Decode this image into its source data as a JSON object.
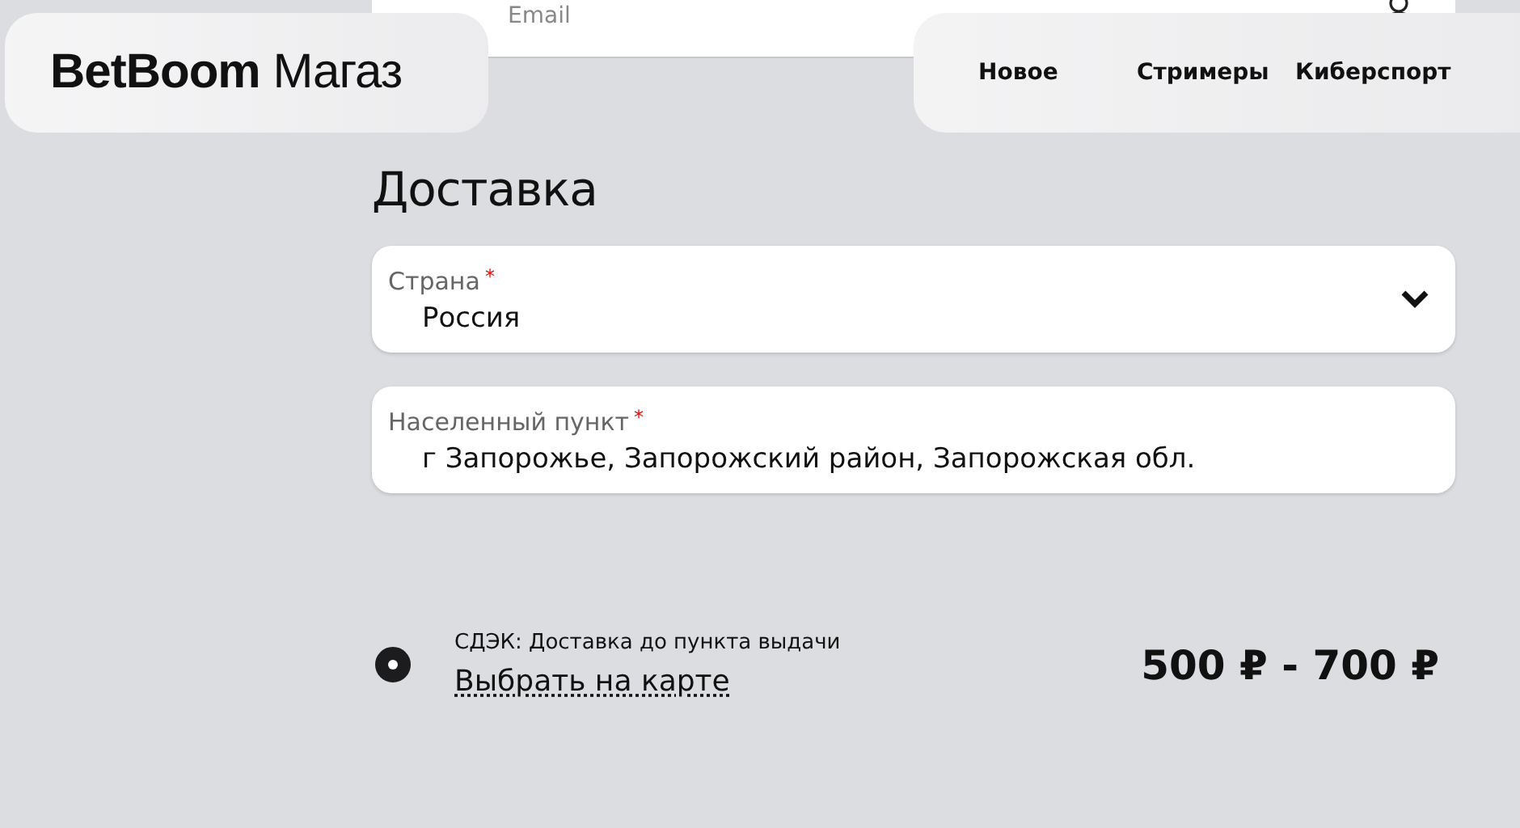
{
  "email_field": {
    "placeholder": "Email"
  },
  "header": {
    "logo": {
      "bold": "BetBoom",
      "rest": "Магаз"
    },
    "nav": [
      {
        "label": "Новое"
      },
      {
        "label": "Стримеры"
      },
      {
        "label": "Киберспорт"
      }
    ]
  },
  "delivery": {
    "title": "Доставка",
    "fields": [
      {
        "kind": "select",
        "label": "Страна",
        "required_mark": "*",
        "value": "Россия"
      },
      {
        "kind": "text",
        "label": "Населенный пункт",
        "required_mark": "*",
        "value": "г Запорожье, Запорожский район, Запорожская обл."
      }
    ],
    "options": [
      {
        "selected": true,
        "name": "СДЭК: Доставка до пункта выдачи",
        "link": "Выбрать на карте",
        "price": "500 ₽ - 700 ₽"
      }
    ]
  }
}
